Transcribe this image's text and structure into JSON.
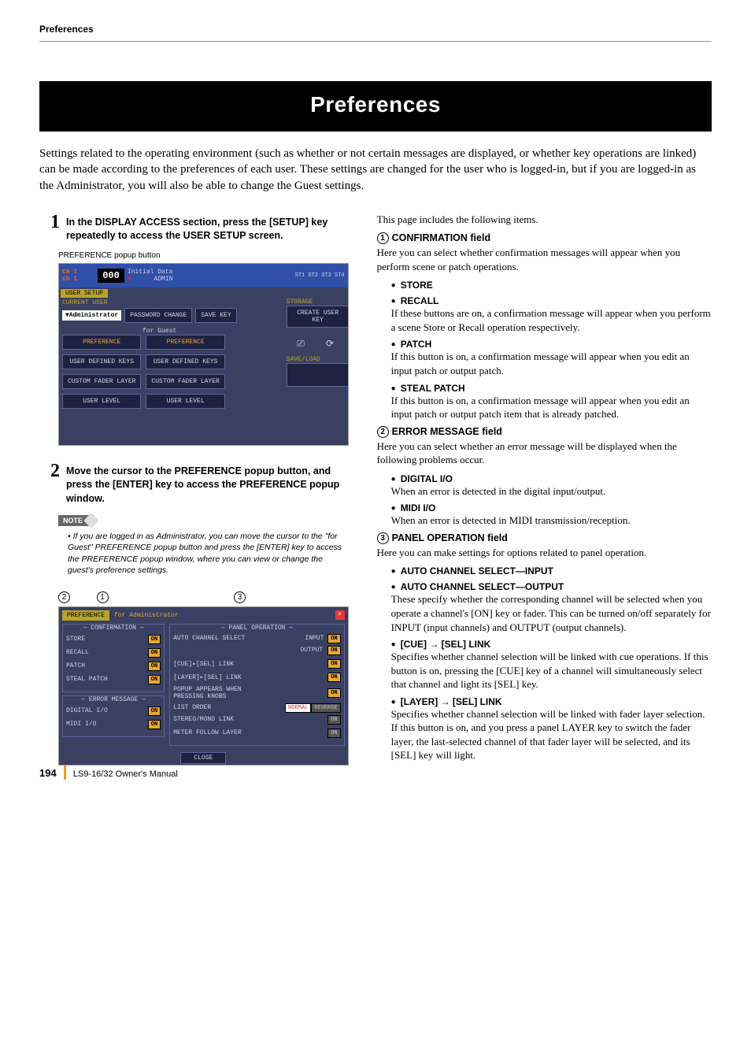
{
  "header": {
    "running": "Preferences"
  },
  "title": "Preferences",
  "intro": "Settings related to the operating environment (such as whether or not certain messages are displayed, or whether key operations are linked) can be made according to the preferences of each user. These settings are changed for the user who is logged-in, but if you are logged-in as the Administrator, you will also be able to change the Guest settings.",
  "steps": {
    "s1": {
      "num": "1",
      "text": "In the DISPLAY ACCESS section, press the [SETUP] key repeatedly to access the USER SETUP screen."
    },
    "caption1": "PREFERENCE popup button",
    "s2": {
      "num": "2",
      "text": "Move the cursor to the PREFERENCE popup button, and press the [ENTER] key to access the PREFERENCE popup window."
    }
  },
  "note": {
    "tag": "NOTE",
    "body": "If you are logged in as Administrator, you can move the cursor to the \"for Guest\" PREFERENCE popup button and press the [ENTER] key to access the PREFERENCE popup window, where you can view or change the guest's preference settings."
  },
  "screenshot1": {
    "ch_line1": "CH 1",
    "ch_line2": "ch 1",
    "scene_num": "000",
    "scene_name": "Initial Data",
    "scene_sub": "R",
    "admin": "ADMIN",
    "meters": "ST1 ST2 ST3 ST4",
    "tab": "USER SETUP",
    "current_user_label": "CURRENT USER",
    "admin_badge": "▼Administrator",
    "pw_change": "PASSWORD CHANGE",
    "save_key": "SAVE KEY",
    "storage_label": "STORAGE",
    "create_user_key": "CREATE USER KEY",
    "for_guest": "for Guest",
    "save_load": "SAVE/LOAD",
    "left_buttons": [
      "PREFERENCE",
      "USER DEFINED KEYS",
      "CUSTOM FADER LAYER",
      "USER LEVEL"
    ],
    "right_buttons": [
      "PREFERENCE",
      "USER DEFINED KEYS",
      "CUSTOM FADER LAYER",
      "USER LEVEL"
    ]
  },
  "callouts": {
    "c1": "1",
    "c2": "2",
    "c3": "3"
  },
  "screenshot2": {
    "tab": "PREFERENCE",
    "subtab": "for Administrator",
    "confirmation": {
      "title": "CONFIRMATION",
      "items": [
        {
          "label": "STORE",
          "state": "ON"
        },
        {
          "label": "RECALL",
          "state": "ON"
        },
        {
          "label": "PATCH",
          "state": "ON"
        },
        {
          "label": "STEAL PATCH",
          "state": "ON"
        }
      ]
    },
    "error": {
      "title": "ERROR MESSAGE",
      "items": [
        {
          "label": "DIGITAL I/O",
          "state": "ON"
        },
        {
          "label": "MIDI I/O",
          "state": "ON"
        }
      ]
    },
    "panel": {
      "title": "PANEL OPERATION",
      "auto_ch": "AUTO CHANNEL SELECT",
      "input_label": "INPUT",
      "input_state": "ON",
      "output_label": "OUTPUT",
      "output_state": "ON",
      "cue_sel": "[CUE]▸[SEL] LINK",
      "cue_sel_state": "ON",
      "layer_sel": "[LAYER]▸[SEL] LINK",
      "layer_sel_state": "ON",
      "popup": "POPUP APPEARS WHEN PRESSING KNOBS",
      "popup_state": "ON",
      "list_order": "LIST ORDER",
      "list_normal": "NORMAL",
      "list_reverse": "REVERSE",
      "stereo_mono": "STEREO/MONO LINK",
      "stereo_mono_state": "ON",
      "meter_follow": "METER FOLLOW LAYER",
      "meter_follow_state": "ON"
    },
    "close": "CLOSE"
  },
  "right": {
    "lead": "This page includes the following items.",
    "f1": {
      "num": "1",
      "title": "CONFIRMATION field",
      "desc": "Here you can select whether confirmation messages will appear when you perform scene or patch operations.",
      "store": "STORE",
      "recall": "RECALL",
      "store_recall_desc": "If these buttons are on, a confirmation message will appear when you perform a scene Store or Recall operation respectively.",
      "patch": "PATCH",
      "patch_desc": "If this button is on, a confirmation message will appear when you edit an input patch or output patch.",
      "steal": "STEAL PATCH",
      "steal_desc": "If this button is on, a confirmation message will appear when you edit an input patch or output patch item that is already patched."
    },
    "f2": {
      "num": "2",
      "title": "ERROR MESSAGE field",
      "desc": "Here you can select whether an error message will be displayed when the following problems occur.",
      "digital": "DIGITAL I/O",
      "digital_desc": "When an error is detected in the digital input/output.",
      "midi": "MIDI I/O",
      "midi_desc": "When an error is detected in MIDI transmission/reception."
    },
    "f3": {
      "num": "3",
      "title": "PANEL OPERATION field",
      "desc": "Here you can make settings for options related to panel operation.",
      "auto_in": "AUTO CHANNEL SELECT—INPUT",
      "auto_out": "AUTO CHANNEL SELECT—OUTPUT",
      "auto_desc": "These specify whether the corresponding channel will be selected when you operate a channel's [ON] key or fader. This can be turned on/off separately for INPUT (input channels) and OUTPUT (output channels).",
      "cue": "[CUE] → [SEL] LINK",
      "cue_desc": "Specifies whether channel selection will be linked with cue operations. If this button is on, pressing the [CUE] key of a channel will simultaneously select that channel and light its [SEL] key.",
      "layer": "[LAYER] → [SEL] LINK",
      "layer_desc": "Specifies whether channel selection will be linked with fader layer selection. If this button is on, and you press a panel LAYER key to switch the fader layer, the last-selected channel of that fader layer will be selected, and its [SEL] key will light."
    }
  },
  "footer": {
    "page": "194",
    "doc": "LS9-16/32  Owner's Manual"
  }
}
